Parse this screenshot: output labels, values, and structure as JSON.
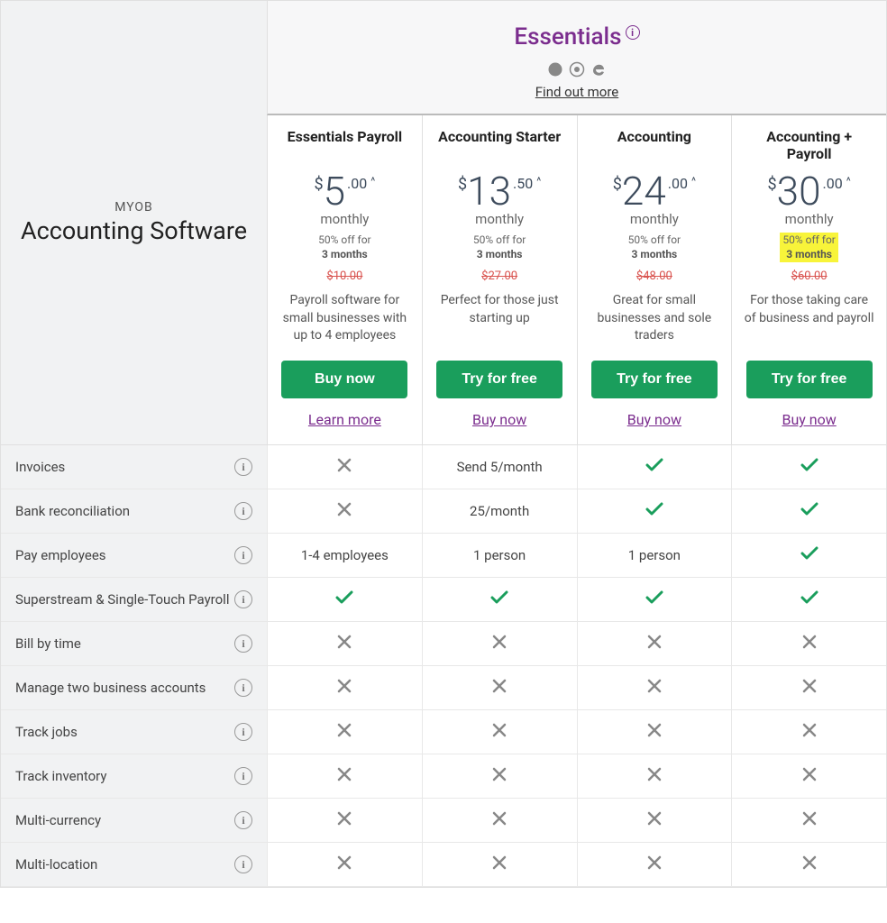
{
  "header": {
    "title": "Essentials",
    "find_more": "Find out more"
  },
  "side": {
    "brand": "MYOB",
    "title": "Accounting Software"
  },
  "plans": [
    {
      "name": "Essentials Payroll",
      "big": "5",
      "cents": ".00",
      "period": "monthly",
      "discount_l1": "50% off for",
      "discount_l2": "3 months",
      "highlight": false,
      "original": "$10.00",
      "desc": "Payroll software for small businesses with up to 4 employees",
      "primary": "Buy now",
      "secondary": "Learn more"
    },
    {
      "name": "Accounting Starter",
      "big": "13",
      "cents": ".50",
      "period": "monthly",
      "discount_l1": "50% off for",
      "discount_l2": "3 months",
      "highlight": false,
      "original": "$27.00",
      "desc": "Perfect for those just starting up",
      "primary": "Try for free",
      "secondary": "Buy now"
    },
    {
      "name": "Accounting",
      "big": "24",
      "cents": ".00",
      "period": "monthly",
      "discount_l1": "50% off for",
      "discount_l2": "3 months",
      "highlight": false,
      "original": "$48.00",
      "desc": "Great for small businesses and sole traders",
      "primary": "Try for free",
      "secondary": "Buy now"
    },
    {
      "name": "Accounting + Payroll",
      "big": "30",
      "cents": ".00",
      "period": "monthly",
      "discount_l1": "50% off for",
      "discount_l2": "3 months",
      "highlight": true,
      "original": "$60.00",
      "desc": "For those taking care of business and payroll",
      "primary": "Try for free",
      "secondary": "Buy now"
    }
  ],
  "features": [
    {
      "label": "Invoices",
      "cells": [
        "x",
        "Send 5/month",
        "check",
        "check"
      ]
    },
    {
      "label": "Bank reconciliation",
      "cells": [
        "x",
        "25/month",
        "check",
        "check"
      ]
    },
    {
      "label": "Pay employees",
      "cells": [
        "1-4 employees",
        "1 person",
        "1 person",
        "check"
      ]
    },
    {
      "label": "Superstream & Single-Touch Payroll",
      "cells": [
        "check",
        "check",
        "check",
        "check"
      ]
    },
    {
      "label": "Bill by time",
      "cells": [
        "x",
        "x",
        "x",
        "x"
      ]
    },
    {
      "label": "Manage two business accounts",
      "cells": [
        "x",
        "x",
        "x",
        "x"
      ]
    },
    {
      "label": "Track jobs",
      "cells": [
        "x",
        "x",
        "x",
        "x"
      ]
    },
    {
      "label": "Track inventory",
      "cells": [
        "x",
        "x",
        "x",
        "x"
      ]
    },
    {
      "label": "Multi-currency",
      "cells": [
        "x",
        "x",
        "x",
        "x"
      ]
    },
    {
      "label": "Multi-location",
      "cells": [
        "x",
        "x",
        "x",
        "x"
      ]
    }
  ]
}
